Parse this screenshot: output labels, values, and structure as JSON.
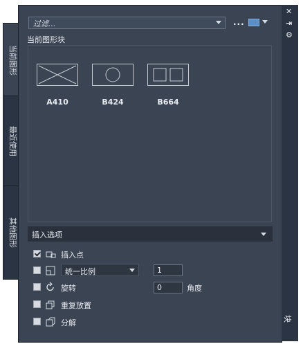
{
  "filter": {
    "placeholder": "过滤..."
  },
  "toolbar": {
    "more_label": "..."
  },
  "tabs": [
    {
      "label": "当前图形",
      "active": true
    },
    {
      "label": "最近使用",
      "active": false
    },
    {
      "label": "其他图形",
      "active": false
    }
  ],
  "section_title": "当前图形块",
  "blocks": [
    {
      "name": "A410",
      "icon": "rect-with-x-icon"
    },
    {
      "name": "B424",
      "icon": "rect-with-circle-icon"
    },
    {
      "name": "B664",
      "icon": "rect-with-two-squares-icon"
    }
  ],
  "insert_options": {
    "header": "插入选项",
    "insertion_point": {
      "label": "插入点",
      "checked": true
    },
    "scale": {
      "checked": false,
      "mode": "统一比例",
      "value": "1"
    },
    "rotation": {
      "label": "旋转",
      "checked": false,
      "value": "0",
      "unit": "角度"
    },
    "repeat": {
      "label": "重复放置",
      "checked": false
    },
    "explode": {
      "label": "分解",
      "checked": false
    }
  },
  "titlebar": {
    "label": "块"
  },
  "colors": {
    "panel": "#3b4453",
    "tab": "#2b3442",
    "accent": "#5b8fc6"
  }
}
